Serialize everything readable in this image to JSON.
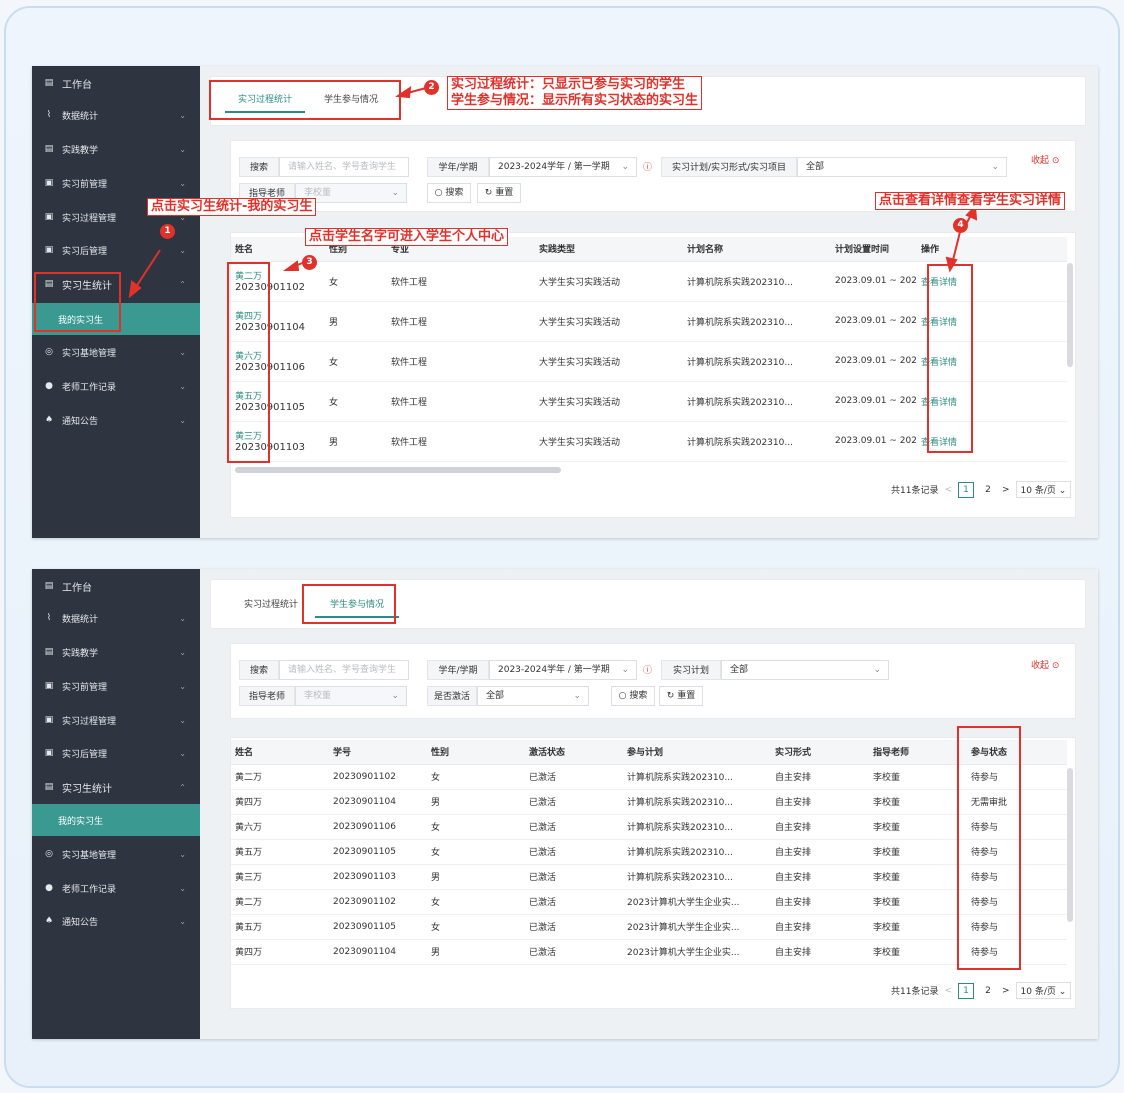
{
  "sidebar": {
    "items": [
      {
        "label": "工作台",
        "icon": "doc-icon"
      },
      {
        "label": "数据统计",
        "icon": "chart-icon"
      },
      {
        "label": "实践教学",
        "icon": "doc-icon"
      },
      {
        "label": "实习前管理",
        "icon": "folder-icon"
      },
      {
        "label": "实习过程管理",
        "icon": "folder-icon"
      },
      {
        "label": "实习后管理",
        "icon": "folder-icon"
      },
      {
        "label": "实习生统计",
        "icon": "doc-icon"
      },
      {
        "label": "实习基地管理",
        "icon": "location-icon"
      },
      {
        "label": "老师工作记录",
        "icon": "user-icon"
      },
      {
        "label": "通知公告",
        "icon": "bell-icon"
      }
    ],
    "sub_label": "我的实习生"
  },
  "tabs": [
    "实习过程统计",
    "学生参与情况"
  ],
  "filters": {
    "search_label": "搜索",
    "search_placeholder": "请输入姓名、学号查询学生",
    "term_label": "学年/学期",
    "term_value": "2023-2024学年 / 第一学期",
    "plan_label_1": "实习计划/实习形式/实习项目",
    "plan_label_2": "实习计划",
    "all": "全部",
    "teacher_label": "指导老师",
    "teacher_value": "李校董",
    "active_label": "是否激活",
    "search_btn": "搜索",
    "reset_btn": "重置",
    "collapse": "收起"
  },
  "table1": {
    "headers": [
      "姓名",
      "性别",
      "专业",
      "实践类型",
      "计划名称",
      "计划设置时间",
      "操作"
    ],
    "rows": [
      {
        "name": "黄二万",
        "id": "20230901102",
        "gender": "女",
        "major": "软件工程",
        "type": "大学生实习实践活动",
        "plan": "计算机院系实践202310...",
        "time": "2023.09.01 ~ 202",
        "action": "查看详情"
      },
      {
        "name": "黄四万",
        "id": "20230901104",
        "gender": "男",
        "major": "软件工程",
        "type": "大学生实习实践活动",
        "plan": "计算机院系实践202310...",
        "time": "2023.09.01 ~ 202",
        "action": "查看详情"
      },
      {
        "name": "黄六万",
        "id": "20230901106",
        "gender": "女",
        "major": "软件工程",
        "type": "大学生实习实践活动",
        "plan": "计算机院系实践202310...",
        "time": "2023.09.01 ~ 202",
        "action": "查看详情"
      },
      {
        "name": "黄五万",
        "id": "20230901105",
        "gender": "女",
        "major": "软件工程",
        "type": "大学生实习实践活动",
        "plan": "计算机院系实践202310...",
        "time": "2023.09.01 ~ 202",
        "action": "查看详情"
      },
      {
        "name": "黄三万",
        "id": "20230901103",
        "gender": "男",
        "major": "软件工程",
        "type": "大学生实习实践活动",
        "plan": "计算机院系实践202310...",
        "time": "2023.09.01 ~ 202",
        "action": "查看详情"
      }
    ]
  },
  "table2": {
    "headers": [
      "姓名",
      "学号",
      "性别",
      "激活状态",
      "参与计划",
      "实习形式",
      "指导老师",
      "参与状态"
    ],
    "rows": [
      {
        "name": "黄二万",
        "id": "20230901102",
        "gender": "女",
        "active": "已激活",
        "plan": "计算机院系实践202310...",
        "form": "自主安排",
        "teacher": "李校董",
        "status": "待参与"
      },
      {
        "name": "黄四万",
        "id": "20230901104",
        "gender": "男",
        "active": "已激活",
        "plan": "计算机院系实践202310...",
        "form": "自主安排",
        "teacher": "李校董",
        "status": "无需审批"
      },
      {
        "name": "黄六万",
        "id": "20230901106",
        "gender": "女",
        "active": "已激活",
        "plan": "计算机院系实践202310...",
        "form": "自主安排",
        "teacher": "李校董",
        "status": "待参与"
      },
      {
        "name": "黄五万",
        "id": "20230901105",
        "gender": "女",
        "active": "已激活",
        "plan": "计算机院系实践202310...",
        "form": "自主安排",
        "teacher": "李校董",
        "status": "待参与"
      },
      {
        "name": "黄三万",
        "id": "20230901103",
        "gender": "男",
        "active": "已激活",
        "plan": "计算机院系实践202310...",
        "form": "自主安排",
        "teacher": "李校董",
        "status": "待参与"
      },
      {
        "name": "黄二万",
        "id": "20230901102",
        "gender": "女",
        "active": "已激活",
        "plan": "2023计算机大学生企业实...",
        "form": "自主安排",
        "teacher": "李校董",
        "status": "待参与"
      },
      {
        "name": "黄五万",
        "id": "20230901105",
        "gender": "女",
        "active": "已激活",
        "plan": "2023计算机大学生企业实...",
        "form": "自主安排",
        "teacher": "李校董",
        "status": "待参与"
      },
      {
        "name": "黄四万",
        "id": "20230901104",
        "gender": "男",
        "active": "已激活",
        "plan": "2023计算机大学生企业实...",
        "form": "自主安排",
        "teacher": "李校董",
        "status": "待参与"
      }
    ]
  },
  "pager": {
    "total": "共11条记录",
    "page1": "1",
    "page2": "2",
    "size": "10 条/页"
  },
  "annotations": {
    "a1": "点击实习生统计-我的实习生",
    "a2_line1": "实习过程统计：只显示已参与实习的学生",
    "a2_line2": "学生参与情况：显示所有实习状态的实习生",
    "a3": "点击学生名字可进入学生个人中心",
    "a4": "点击查看详情查看学生实习详情",
    "b1": "1",
    "b2": "2",
    "b3": "3",
    "b4": "4"
  }
}
